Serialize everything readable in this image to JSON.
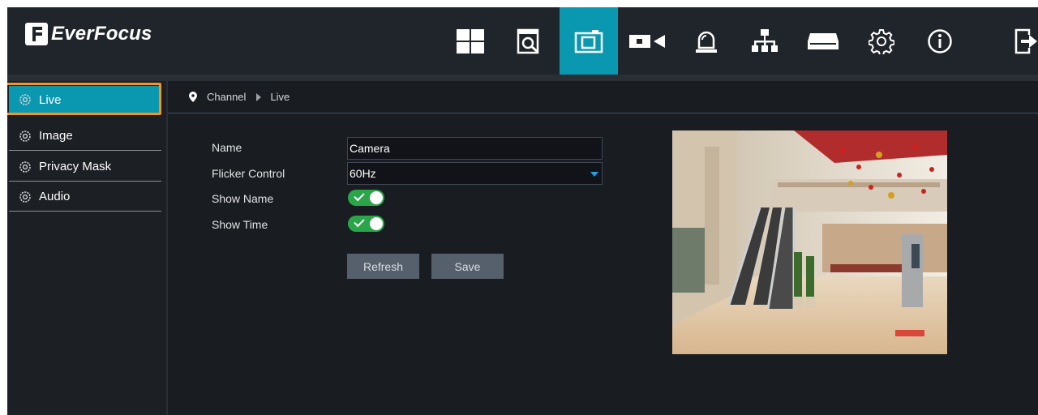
{
  "brand": {
    "name": "EverFocus"
  },
  "topnav": {
    "items": [
      {
        "icon": "layout-grid-icon",
        "active": false
      },
      {
        "icon": "playback-icon",
        "active": false
      },
      {
        "icon": "camera-settings-icon",
        "active": true
      },
      {
        "icon": "video-camera-icon",
        "active": false
      },
      {
        "icon": "alarm-icon",
        "active": false
      },
      {
        "icon": "network-icon",
        "active": false
      },
      {
        "icon": "storage-icon",
        "active": false
      },
      {
        "icon": "settings-icon",
        "active": false
      },
      {
        "icon": "info-icon",
        "active": false
      },
      {
        "icon": "logout-icon",
        "active": false
      }
    ],
    "accent": "#0a98b0"
  },
  "sidebar": {
    "items": [
      {
        "label": "Live",
        "active": true
      },
      {
        "label": "Image",
        "active": false
      },
      {
        "label": "Privacy Mask",
        "active": false
      },
      {
        "label": "Audio",
        "active": false
      }
    ],
    "highlight_color": "#f7931e"
  },
  "breadcrumb": {
    "channel": "Channel",
    "page": "Live"
  },
  "form": {
    "name_label": "Name",
    "name_value": "Camera",
    "flicker_label": "Flicker Control",
    "flicker_value": "60Hz",
    "show_name_label": "Show Name",
    "show_name_on": true,
    "show_time_label": "Show Time",
    "show_time_on": true,
    "refresh_label": "Refresh",
    "save_label": "Save"
  },
  "preview": {
    "scene": "camera-preview-image"
  }
}
